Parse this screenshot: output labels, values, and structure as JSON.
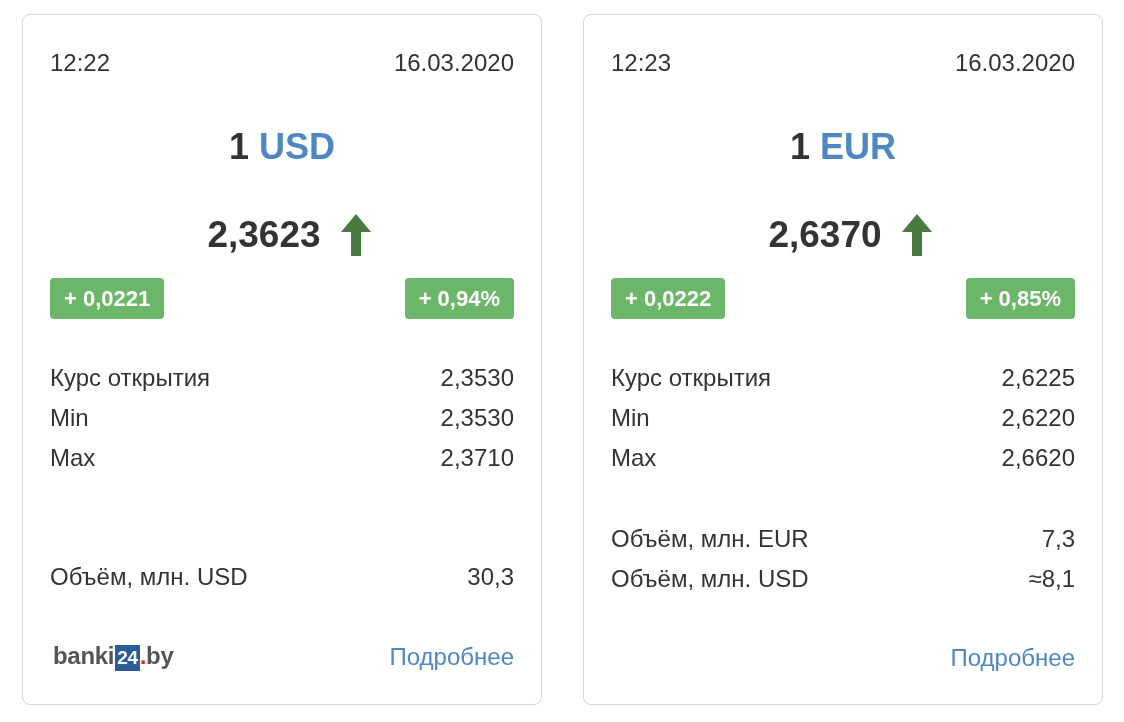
{
  "cards": [
    {
      "time": "12:22",
      "date": "16.03.2020",
      "amount": "1",
      "currency": "USD",
      "rate": "2,3623",
      "rising": true,
      "change": "+ 0,0221",
      "change_percent": "+ 0,94%",
      "stats": [
        {
          "label": "Курс открытия",
          "value": "2,3530"
        },
        {
          "label": "Min",
          "value": "2,3530"
        },
        {
          "label": "Max",
          "value": "2,3710"
        }
      ],
      "volumes": [
        {
          "label": "Объём, млн. USD",
          "value": "30,3"
        }
      ],
      "logo": {
        "prefix": "banki",
        "number": "24",
        "dot": ".",
        "suffix": "by"
      },
      "link": "Подробнее"
    },
    {
      "time": "12:23",
      "date": "16.03.2020",
      "amount": "1",
      "currency": "EUR",
      "rate": "2,6370",
      "rising": true,
      "change": "+ 0,0222",
      "change_percent": "+ 0,85%",
      "stats": [
        {
          "label": "Курс открытия",
          "value": "2,6225"
        },
        {
          "label": "Min",
          "value": "2,6220"
        },
        {
          "label": "Max",
          "value": "2,6620"
        }
      ],
      "volumes": [
        {
          "label": "Объём, млн. EUR",
          "value": "7,3"
        },
        {
          "label": "Объём, млн. USD",
          "value": "≈8,1"
        }
      ],
      "link": "Подробнее"
    }
  ]
}
